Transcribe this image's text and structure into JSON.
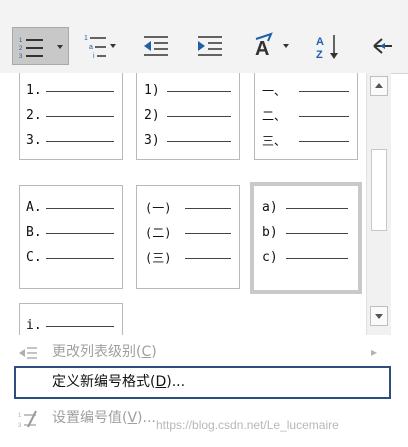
{
  "toolbar": {
    "buttons": [
      {
        "name": "numbering-button",
        "icon": "numbered-list-icon",
        "has_dropdown": true,
        "active": true
      },
      {
        "name": "multilevel-list-button",
        "icon": "multilevel-list-icon",
        "has_dropdown": true
      },
      {
        "name": "decrease-indent-button",
        "icon": "decrease-indent-icon"
      },
      {
        "name": "increase-indent-button",
        "icon": "increase-indent-icon"
      },
      {
        "name": "chinese-layout-button",
        "icon": "chinese-layout-icon",
        "has_dropdown": true
      },
      {
        "name": "sort-button",
        "icon": "sort-az-icon"
      },
      {
        "name": "show-hide-marks-button",
        "icon": "show-hide-icon"
      }
    ]
  },
  "numbering_library": {
    "formats": [
      {
        "markers": [
          "1.",
          "2.",
          "3."
        ]
      },
      {
        "markers": [
          "1)",
          "2)",
          "3)"
        ]
      },
      {
        "markers": [
          "一、",
          "二、",
          "三、"
        ]
      },
      {
        "markers": [
          "A.",
          "B.",
          "C."
        ]
      },
      {
        "markers": [
          "(一)",
          "(二)",
          "(三)"
        ]
      },
      {
        "markers": [
          "a)",
          "b)",
          "c)"
        ],
        "selected": true
      },
      {
        "markers": [
          "i."
        ]
      }
    ]
  },
  "menu": {
    "change_list_level": {
      "text": "更改列表级别(",
      "key": "C",
      "end": ")"
    },
    "define_new_format": {
      "text": "定义新编号格式(",
      "key": "D",
      "end": ")..."
    },
    "set_numbering_value": {
      "text": "设置编号值(",
      "key": "V",
      "end": ")..."
    }
  },
  "watermark": "https://blog.csdn.net/Le_lucemaire",
  "colors": {
    "selection_border": "#2b4e7e",
    "active_button_bg": "#c8c8c8",
    "icon_blue": "#1f5fa8"
  }
}
